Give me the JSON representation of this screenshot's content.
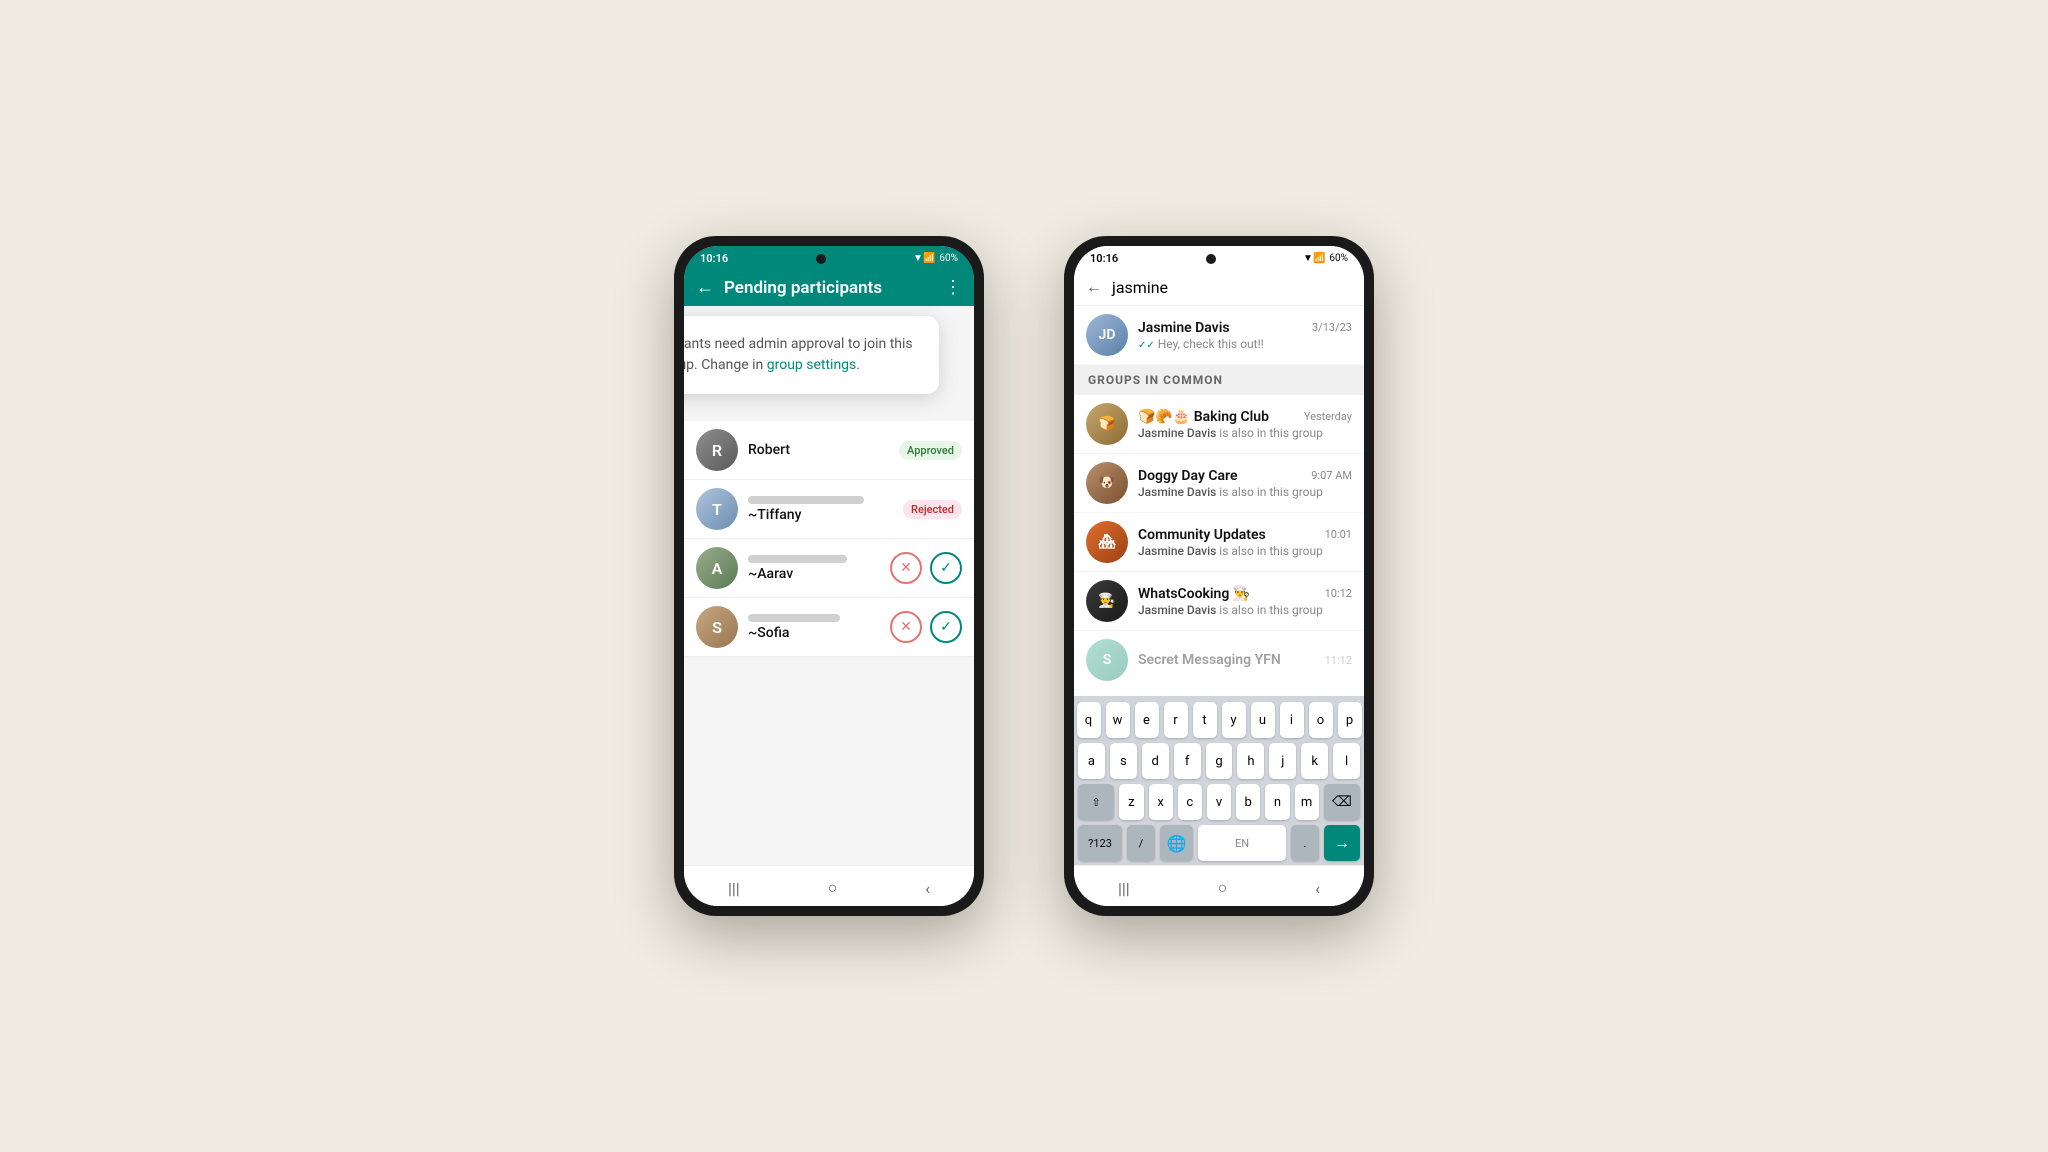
{
  "background": "#f0ece2",
  "phone1": {
    "status_bar": {
      "time": "10:16",
      "battery": "60%",
      "bg": "teal"
    },
    "header": {
      "title": "Pending participants",
      "back_label": "←",
      "more_label": "⋮"
    },
    "tooltip": {
      "text_before": "New participants need admin approval to join this group. Change in ",
      "link": "group settings",
      "text_after": "."
    },
    "participants": [
      {
        "name": "Robert",
        "status": "Approved",
        "type": "approved",
        "avatar_class": "robert"
      },
      {
        "name": "~Tiffany",
        "status": "Rejected",
        "type": "rejected",
        "avatar_class": "tiffany",
        "blurred": true
      },
      {
        "name": "~Aarav",
        "type": "actions",
        "avatar_class": "aarav",
        "blurred": true
      },
      {
        "name": "~Sofia",
        "type": "actions",
        "avatar_class": "sofia",
        "blurred": true
      }
    ],
    "nav": {
      "icons": [
        "|||",
        "○",
        "<"
      ]
    }
  },
  "phone2": {
    "status_bar": {
      "time": "10:16",
      "battery": "60%",
      "bg": "white"
    },
    "search": {
      "query": "jasmine",
      "back_label": "←"
    },
    "recent_chat": {
      "name": "Jasmine Davis",
      "time": "3/13/23",
      "preview": "Hey, check this out!!",
      "avatar_class": "jasmine-av",
      "avatar_emoji": "👤"
    },
    "groups_label": "GROUPS IN COMMON",
    "groups": [
      {
        "name": "🍞🥐🎂 Baking Club",
        "time": "Yesterday",
        "preview_bold": "Jasmine Davis",
        "preview_text": " is also in this group",
        "avatar_class": "baking-av",
        "avatar_emoji": "🍞"
      },
      {
        "name": "Doggy Day Care",
        "time": "9:07 AM",
        "preview_bold": "Jasmine Davis",
        "preview_text": " is also in this group",
        "avatar_class": "doggy-av",
        "avatar_emoji": "🐶"
      },
      {
        "name": "Community Updates",
        "time": "10:01",
        "preview_bold": "Jasmine Davis",
        "preview_text": " is also in this group",
        "avatar_class": "community-av",
        "avatar_emoji": "🏘"
      },
      {
        "name": "WhatsCooking 👨‍🍳",
        "time": "10:12",
        "preview_bold": "Jasmine Davis",
        "preview_text": " is also in this group",
        "avatar_class": "cooking-av",
        "avatar_emoji": "🍳"
      }
    ],
    "keyboard": {
      "rows": [
        [
          "q",
          "w",
          "e",
          "r",
          "t",
          "y",
          "u",
          "i",
          "o",
          "p"
        ],
        [
          "a",
          "s",
          "d",
          "f",
          "g",
          "h",
          "j",
          "k",
          "l"
        ],
        [
          "z",
          "x",
          "c",
          "v",
          "b",
          "n",
          "m"
        ]
      ],
      "special_left": "⇧",
      "special_right": "⌫",
      "bottom_left": "?123",
      "bottom_slash": "/",
      "bottom_globe": "🌐",
      "bottom_lang": "EN",
      "bottom_period": ".",
      "bottom_send": "→"
    },
    "nav": {
      "icons": [
        "|||",
        "○",
        "<"
      ]
    }
  }
}
